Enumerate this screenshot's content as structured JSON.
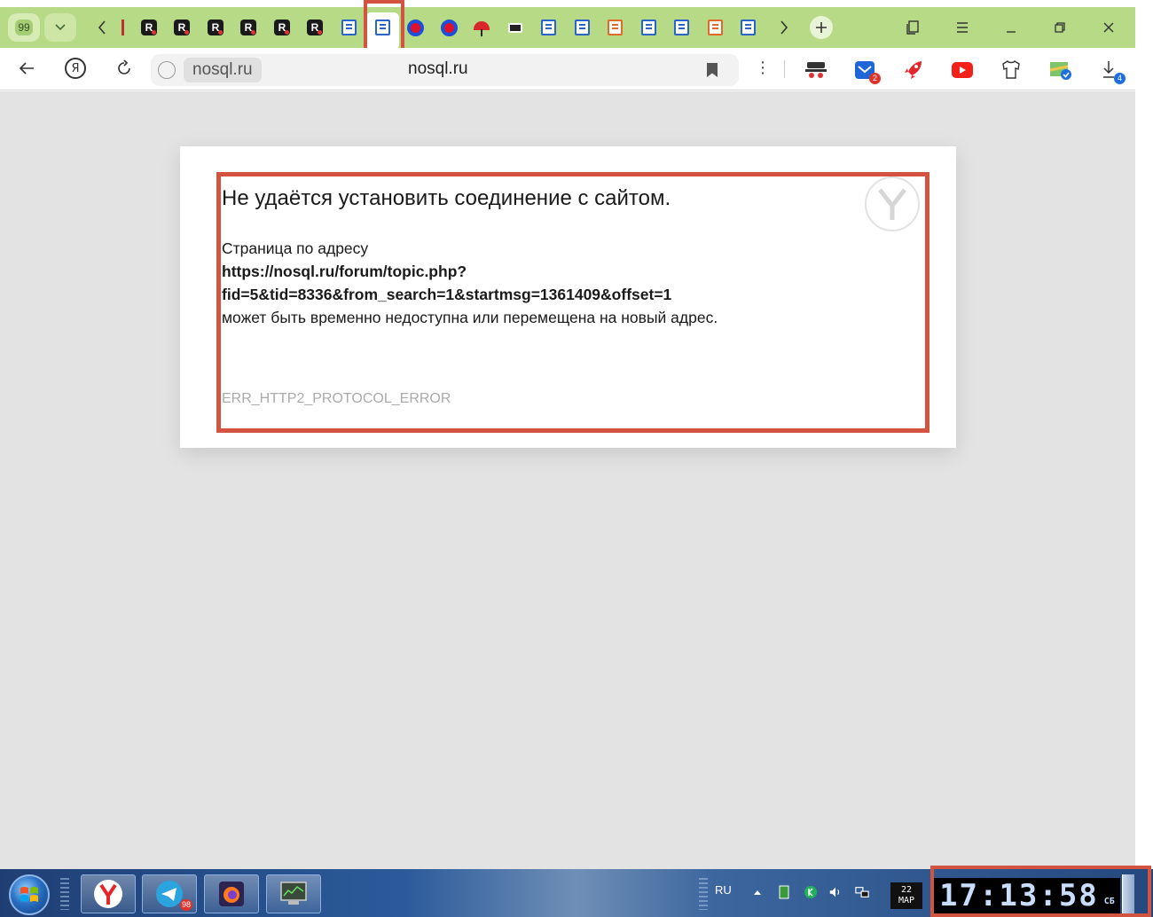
{
  "tabbar": {
    "tab_count": "99",
    "tabs": [
      {
        "icon": "r-logo-icon"
      },
      {
        "icon": "r-logo-icon"
      },
      {
        "icon": "r-logo-icon"
      },
      {
        "icon": "r-logo-icon"
      },
      {
        "icon": "r-logo-icon"
      },
      {
        "icon": "r-logo-icon"
      },
      {
        "icon": "doc-icon"
      },
      {
        "icon": "doc-icon",
        "active": true
      },
      {
        "icon": "ring-icon"
      },
      {
        "icon": "ring-icon"
      },
      {
        "icon": "umbrella-icon"
      },
      {
        "icon": "monitor-icon"
      },
      {
        "icon": "doc-icon"
      },
      {
        "icon": "doc-icon"
      },
      {
        "icon": "doc-orange-icon"
      },
      {
        "icon": "doc-icon"
      },
      {
        "icon": "doc-icon"
      },
      {
        "icon": "doc-orange-icon"
      },
      {
        "icon": "doc-icon"
      }
    ],
    "highlight_color": "#d2533f"
  },
  "addressbar": {
    "domain_chip": "nosql.ru",
    "page_title": "nosql.ru"
  },
  "extensions": {
    "mail_badge": "2",
    "downloads_badge": "4"
  },
  "error_page": {
    "title": "Не удаётся установить соединение с сайтом.",
    "line1": "Страница по адресу",
    "url_line1": "https://nosql.ru/forum/topic.php?",
    "url_line2": "fid=5&tid=8336&from_search=1&startmsg=1361409&offset=1",
    "line2": "может быть временно недоступна или перемещена на новый адрес.",
    "error_code": "ERR_HTTP2_PROTOCOL_ERROR"
  },
  "taskbar": {
    "telegram_badge": "98",
    "language": "RU",
    "date_day": "22",
    "date_month": "МАР",
    "clock_time": "17:13:58",
    "clock_weekday": "СБ"
  }
}
